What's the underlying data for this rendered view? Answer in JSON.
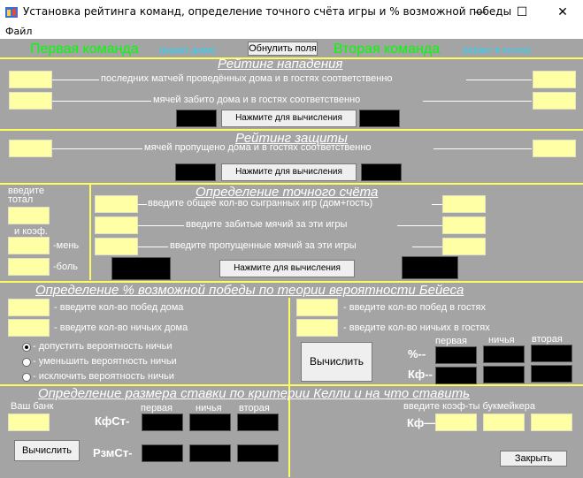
{
  "window": {
    "title": "Установка рейтинга команд, определение точного счёта игры и % возможной победы",
    "minimize": "—",
    "maximize": "☐",
    "close": "✕"
  },
  "menu": {
    "file": "Файл"
  },
  "header": {
    "team1": "Первая команда",
    "team1_note": "(играет дома)",
    "reset_button": "Обнулить поля",
    "team2": "Вторая команда",
    "team2_note": "(играет в гостях)"
  },
  "attack": {
    "heading": "Рейтинг нападения",
    "row1_label": "последних матчей проведённых дома и в гостях соответственно",
    "row2_label": "мячей забито дома и в гостях соответственно",
    "calc_button": "Нажмите для вычисления"
  },
  "defense": {
    "heading": "Рейтинг защиты",
    "row1_label": "мячей пропущено дома и в гостях соответственно",
    "calc_button": "Нажмите для вычисления"
  },
  "score": {
    "heading": "Определение точного счёта",
    "total_label1": "введите",
    "total_label2": "тотал",
    "coef_label": "и коэф.",
    "less_label": "-мень",
    "more_label": "-боль",
    "row1_label": "введите общее кол-во сыгранных игр (дом+гость)",
    "row2_label": "введите  забитые мячий за эти игры",
    "row3_label": "введите  пропущенные мячий за эти игры",
    "calc_button": "Нажмите для вычисления"
  },
  "bayes": {
    "heading": "Определение % возможной победы по теории вероятности Бейеса",
    "home_wins": "- введите кол-во  побед дома",
    "home_draws": "- введите кол-во ничьих дома",
    "away_wins": "- введите кол-во  побед в гостях",
    "away_draws": "- введите кол-во ничьих в гостях",
    "radio1": "- допустить вероятность ничьи",
    "radio2": "- уменьшить вероятность ничьи",
    "radio3": "- исключить вероятность ничьи",
    "calc_button": "Вычислить",
    "col_first": "первая",
    "col_draw": "ничья",
    "col_second": "вторая",
    "row_percent": "%--",
    "row_kf": "Кф--"
  },
  "kelly": {
    "heading": "Определение размера ставки по критерии Келли и на что ставить",
    "bank_label": "Ваш банк",
    "calc_button": "Вычислить",
    "col_first": "первая",
    "col_draw": "ничья",
    "col_second": "вторая",
    "kfst": "КфСт-",
    "rzmst": "РзмСт-",
    "bookmaker_label": "введите коэф-ты букмейкера",
    "kf": "Кф—",
    "close_button": "Закрыть"
  },
  "colors": {
    "background": "#a4a4a4",
    "input": "#ffffa6",
    "separator": "#fdfd60",
    "team_name": "#00ff00",
    "team_note": "#22d6ff"
  }
}
